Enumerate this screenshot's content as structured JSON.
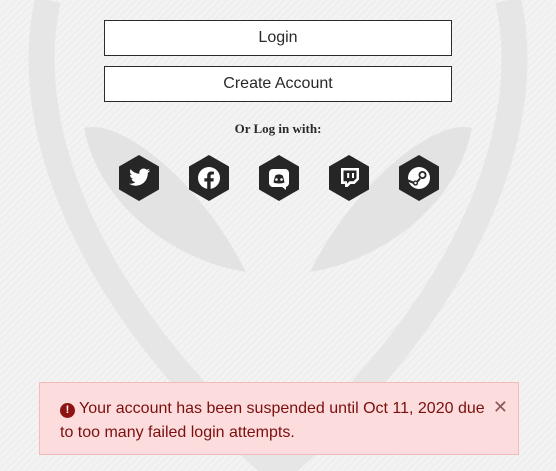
{
  "buttons": {
    "login_label": "Login",
    "create_account_label": "Create Account"
  },
  "social": {
    "heading": "Or Log in with:",
    "providers": [
      {
        "name": "Twitter",
        "icon": "twitter-icon"
      },
      {
        "name": "Facebook",
        "icon": "facebook-icon"
      },
      {
        "name": "Discord",
        "icon": "discord-icon"
      },
      {
        "name": "Twitch",
        "icon": "twitch-icon"
      },
      {
        "name": "Steam",
        "icon": "steam-icon"
      }
    ]
  },
  "alert": {
    "message": "Your account has been suspended until Oct 11, 2020 due to too many failed login attempts.",
    "icon": "exclamation-circle-icon",
    "close_symbol": "✕",
    "color_background": "#fcdcdc",
    "color_text": "#7b0f0f"
  }
}
